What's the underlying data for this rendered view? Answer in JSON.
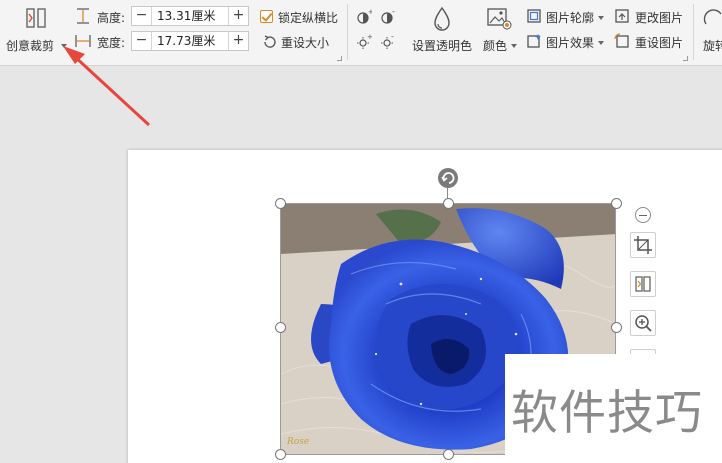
{
  "ribbon": {
    "creative_crop_label": "创意裁剪",
    "height_label": "高度:",
    "height_value": "13.31厘米",
    "width_label": "宽度:",
    "width_value": "17.73厘米",
    "lock_ratio_label": "锁定纵横比",
    "lock_ratio_checked": true,
    "reset_size_label": "重设大小",
    "set_transparent_label": "设置透明色",
    "color_label": "颜色",
    "picture_outline_label": "图片轮廓",
    "picture_effect_label": "图片效果",
    "change_picture_label": "更改图片",
    "reset_picture_label": "重设图片",
    "rotate_label": "旋转",
    "minus_symbol": "−",
    "plus_symbol": "+"
  },
  "workspace": {
    "watermark_text": "软件技巧",
    "accent_color": "#e8453c",
    "photo_signature": "Rose"
  }
}
